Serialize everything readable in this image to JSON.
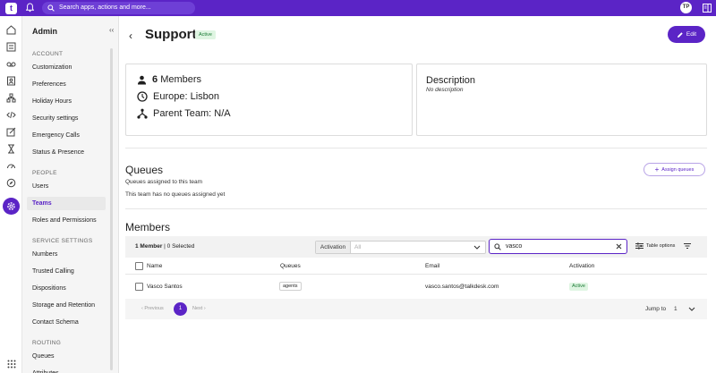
{
  "topbar": {
    "logo": "t",
    "search_placeholder": "Search apps, actions and more...",
    "user_initials": "TP"
  },
  "colors": {
    "brand": "#5b24c6",
    "active_green": "#1a7a35"
  },
  "sidebar": {
    "title": "Admin",
    "sections": [
      {
        "label": "ACCOUNT",
        "items": [
          "Customization",
          "Preferences",
          "Holiday Hours",
          "Security settings",
          "Emergency Calls",
          "Status & Presence"
        ]
      },
      {
        "label": "PEOPLE",
        "items": [
          "Users",
          "Teams",
          "Roles and Permissions"
        ]
      },
      {
        "label": "SERVICE SETTINGS",
        "items": [
          "Numbers",
          "Trusted Calling",
          "Dispositions",
          "Storage and Retention",
          "Contact Schema"
        ]
      },
      {
        "label": "ROUTING",
        "items": [
          "Queues",
          "Attributes"
        ]
      }
    ],
    "active_item": "Teams"
  },
  "header": {
    "title": "Support",
    "status": "Active",
    "edit_label": "Edit"
  },
  "info": {
    "members_count": "6",
    "members_label": "Members",
    "timezone": "Europe: Lisbon",
    "parent_team": "Parent Team: N/A"
  },
  "description": {
    "title": "Description",
    "text": "No description"
  },
  "queues": {
    "title": "Queues",
    "subtitle": "Queues assigned to this team",
    "empty_text": "This team has no queues assigned yet",
    "assign_label": "Assign queues"
  },
  "members": {
    "title": "Members",
    "count_bold": "1 Member",
    "count_rest": " | 0 Selected",
    "filter_label": "Activation",
    "filter_value": "All",
    "search_value": "vasco",
    "table_options_label": "Table options",
    "columns": [
      "Name",
      "Queues",
      "Email",
      "Activation"
    ],
    "rows": [
      {
        "name": "Vasco Santos",
        "queue": "agents",
        "email": "vasco.santos@talkdesk.com",
        "activation": "Active"
      }
    ],
    "pagination": {
      "prev": "Previous",
      "page": "1",
      "next": "Next",
      "jump_label": "Jump to",
      "jump_value": "1"
    }
  }
}
